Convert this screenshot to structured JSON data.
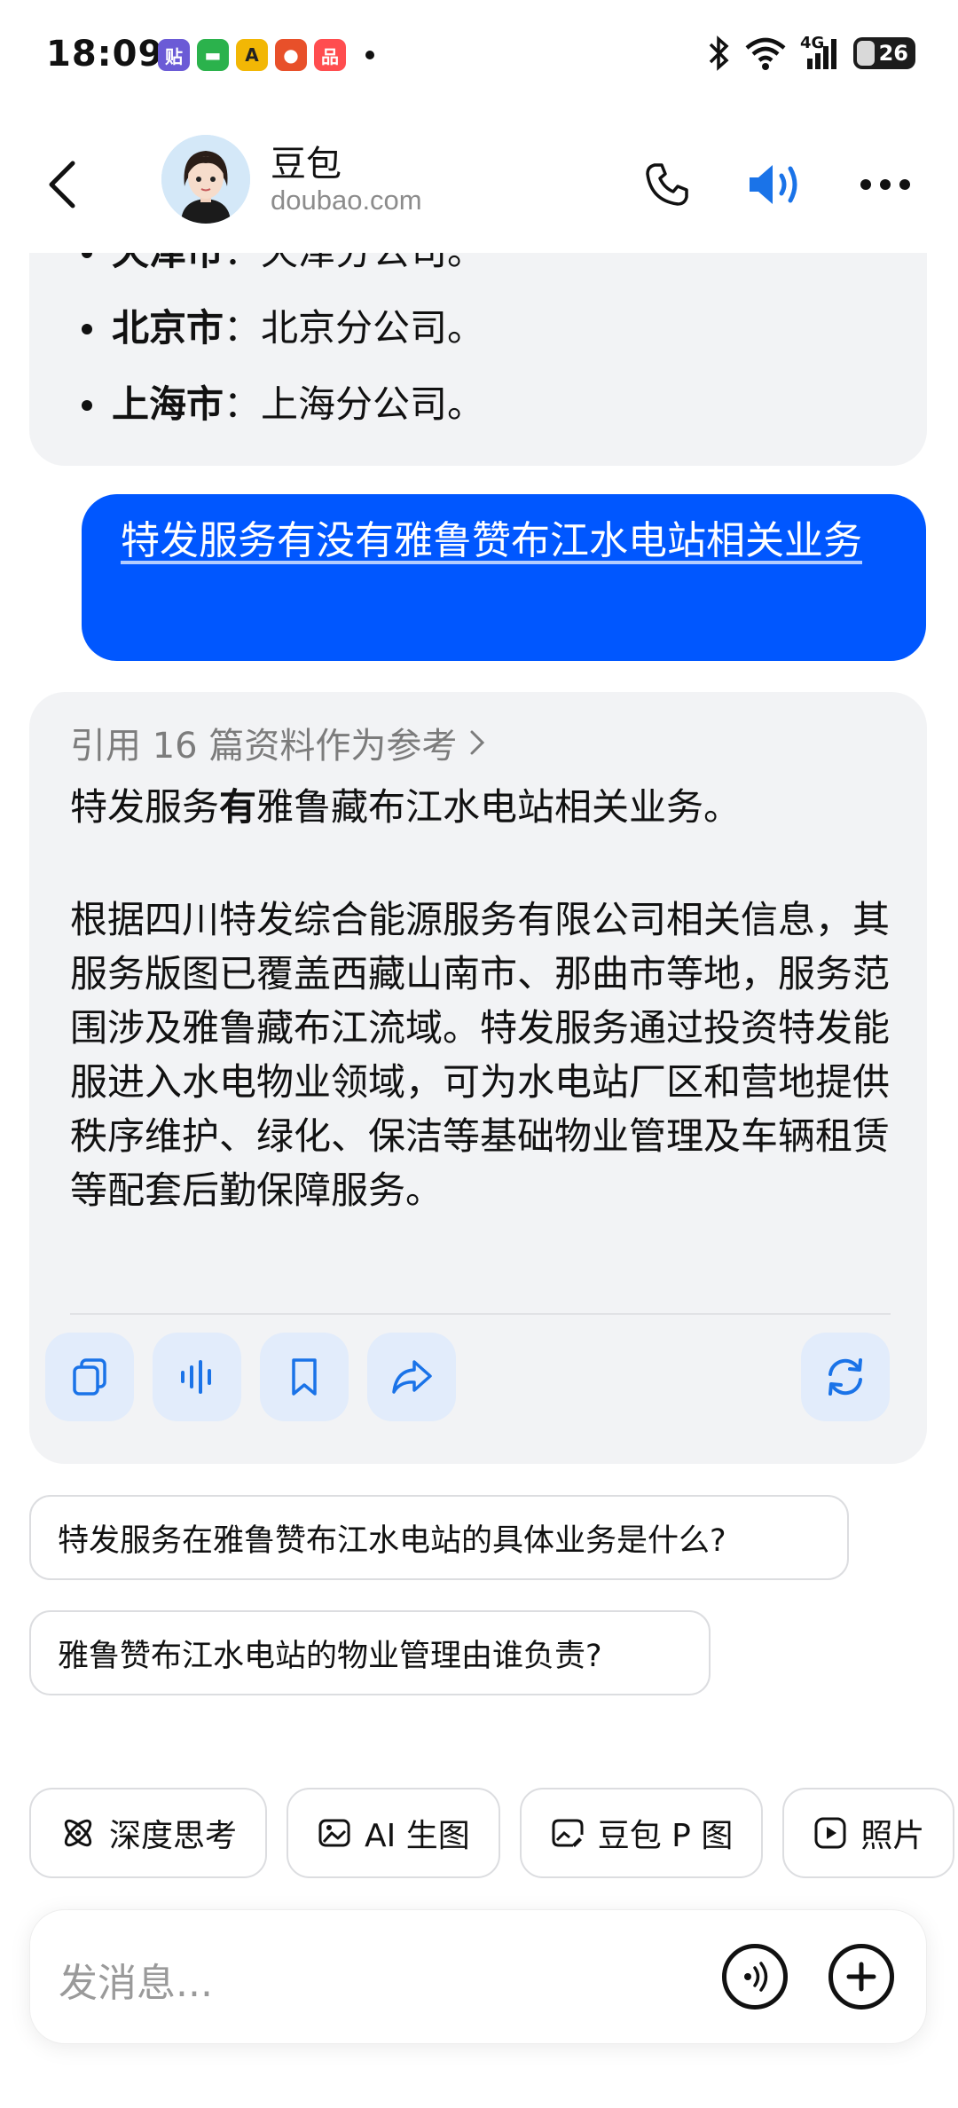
{
  "status": {
    "time": "18:09",
    "network": "4G",
    "battery": "26",
    "colors": {
      "app1": "#6b5bd6",
      "app2": "#2bb24c",
      "app3": "#f2b705",
      "app4": "#e8502a",
      "app5": "#ff4d4f"
    }
  },
  "header": {
    "name": "豆包",
    "subtitle": "doubao.com",
    "accent": "#1a73e8"
  },
  "prev_message": {
    "items": [
      {
        "bold": "天津市",
        "text": "：天津分公司。"
      },
      {
        "bold": "北京市",
        "text": "：北京分公司。"
      },
      {
        "bold": "上海市",
        "text": "：上海分公司。"
      }
    ]
  },
  "user_message": {
    "text": "特发服务有没有雅鲁赞布江水电站相关业务"
  },
  "reply": {
    "refs": "引用 16 篇资料作为参考",
    "line1_pre": "特发服务",
    "line1_bold": "有",
    "line1_post": "雅鲁藏布江水电站相关业务。",
    "para2": "根据四川特发综合能源服务有限公司相关信息，其服务版图已覆盖西藏山南市、那曲市等地，服务范围涉及雅鲁藏布江流域。特发服务通过投资特发能服进入水电物业领域，可为水电站厂区和营地提供秩序维护、绿化、保洁等基础物业管理及车辆租赁等配套后勤保障服务。"
  },
  "suggestions": [
    "特发服务在雅鲁赞布江水电站的具体业务是什么?",
    "雅鲁赞布江水电站的物业管理由谁负责?"
  ],
  "tools": {
    "deep": "深度思考",
    "ai": "AI 生图",
    "p": "豆包 P 图",
    "photo": "照片"
  },
  "input": {
    "placeholder": "发消息..."
  }
}
